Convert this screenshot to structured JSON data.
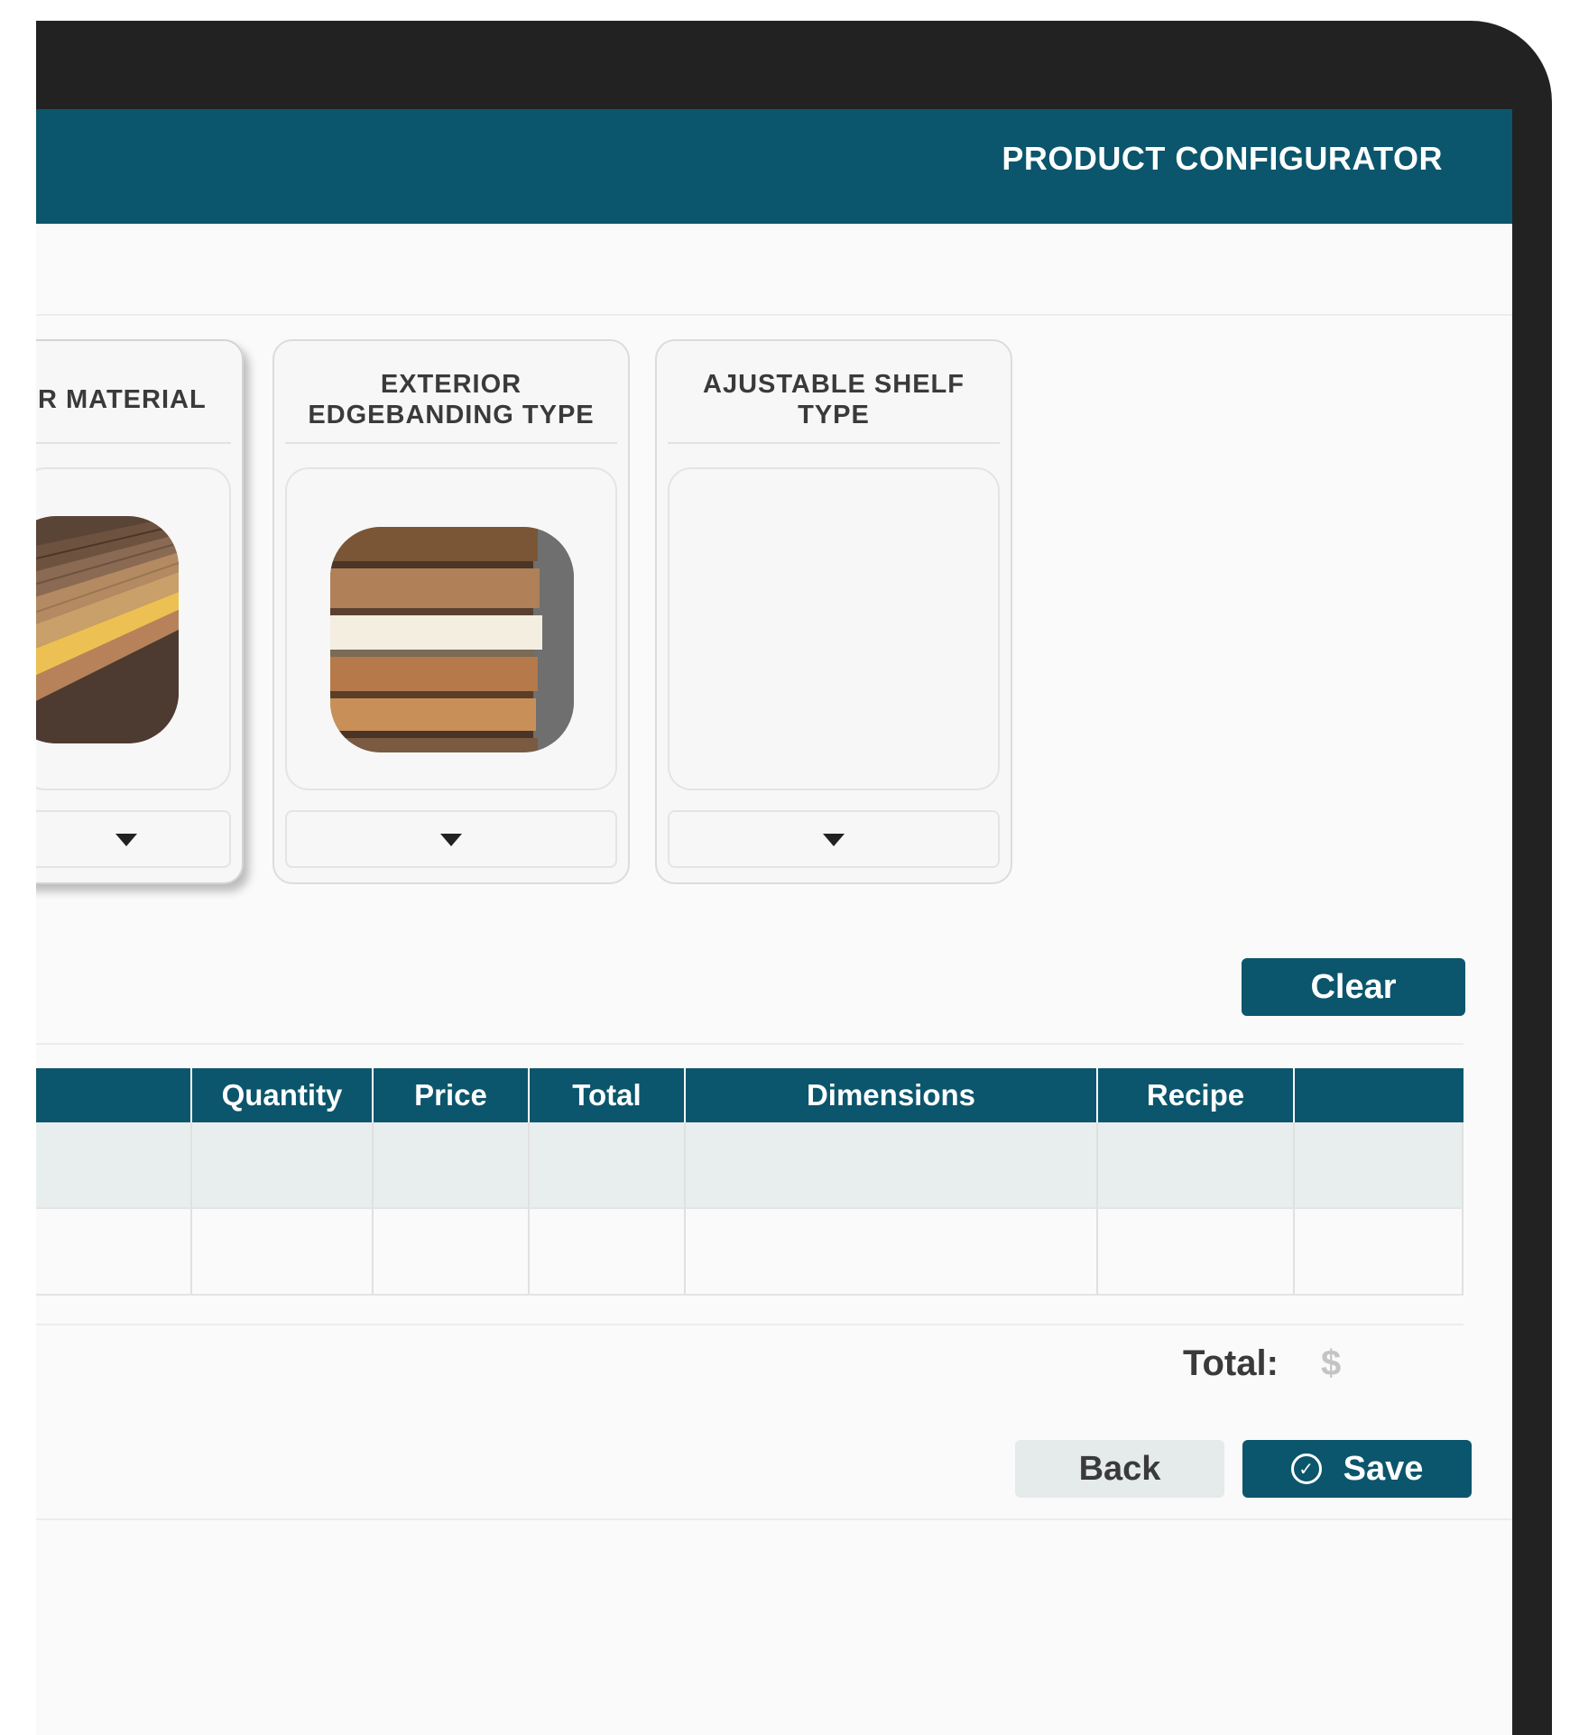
{
  "header": {
    "title": "PRODUCT CONFIGURATOR"
  },
  "cards": [
    {
      "title": "R MATERIAL",
      "image": "wood-sample-panels",
      "state": "selected"
    },
    {
      "title": "EXTERIOR EDGEBANDING TYPE",
      "image": "edgebanding-rolls"
    },
    {
      "title": "AJUSTABLE SHELF TYPE",
      "image": ""
    }
  ],
  "actions": {
    "clear_label": "Clear",
    "back_label": "Back",
    "save_label": "Save"
  },
  "table": {
    "columns": [
      "Quantity",
      "Price",
      "Total",
      "Dimensions",
      "Recipe",
      ""
    ],
    "rows": [
      [
        "",
        "",
        "",
        "",
        "",
        "",
        ""
      ],
      [
        "",
        "",
        "",
        "",
        "",
        "",
        ""
      ]
    ]
  },
  "summary": {
    "total_label": "Total:",
    "total_value": "$"
  },
  "colors": {
    "brand": "#0b566c",
    "frame": "#222222",
    "row_shade": "#e8eeee",
    "secondary_button": "#e5eaea"
  }
}
